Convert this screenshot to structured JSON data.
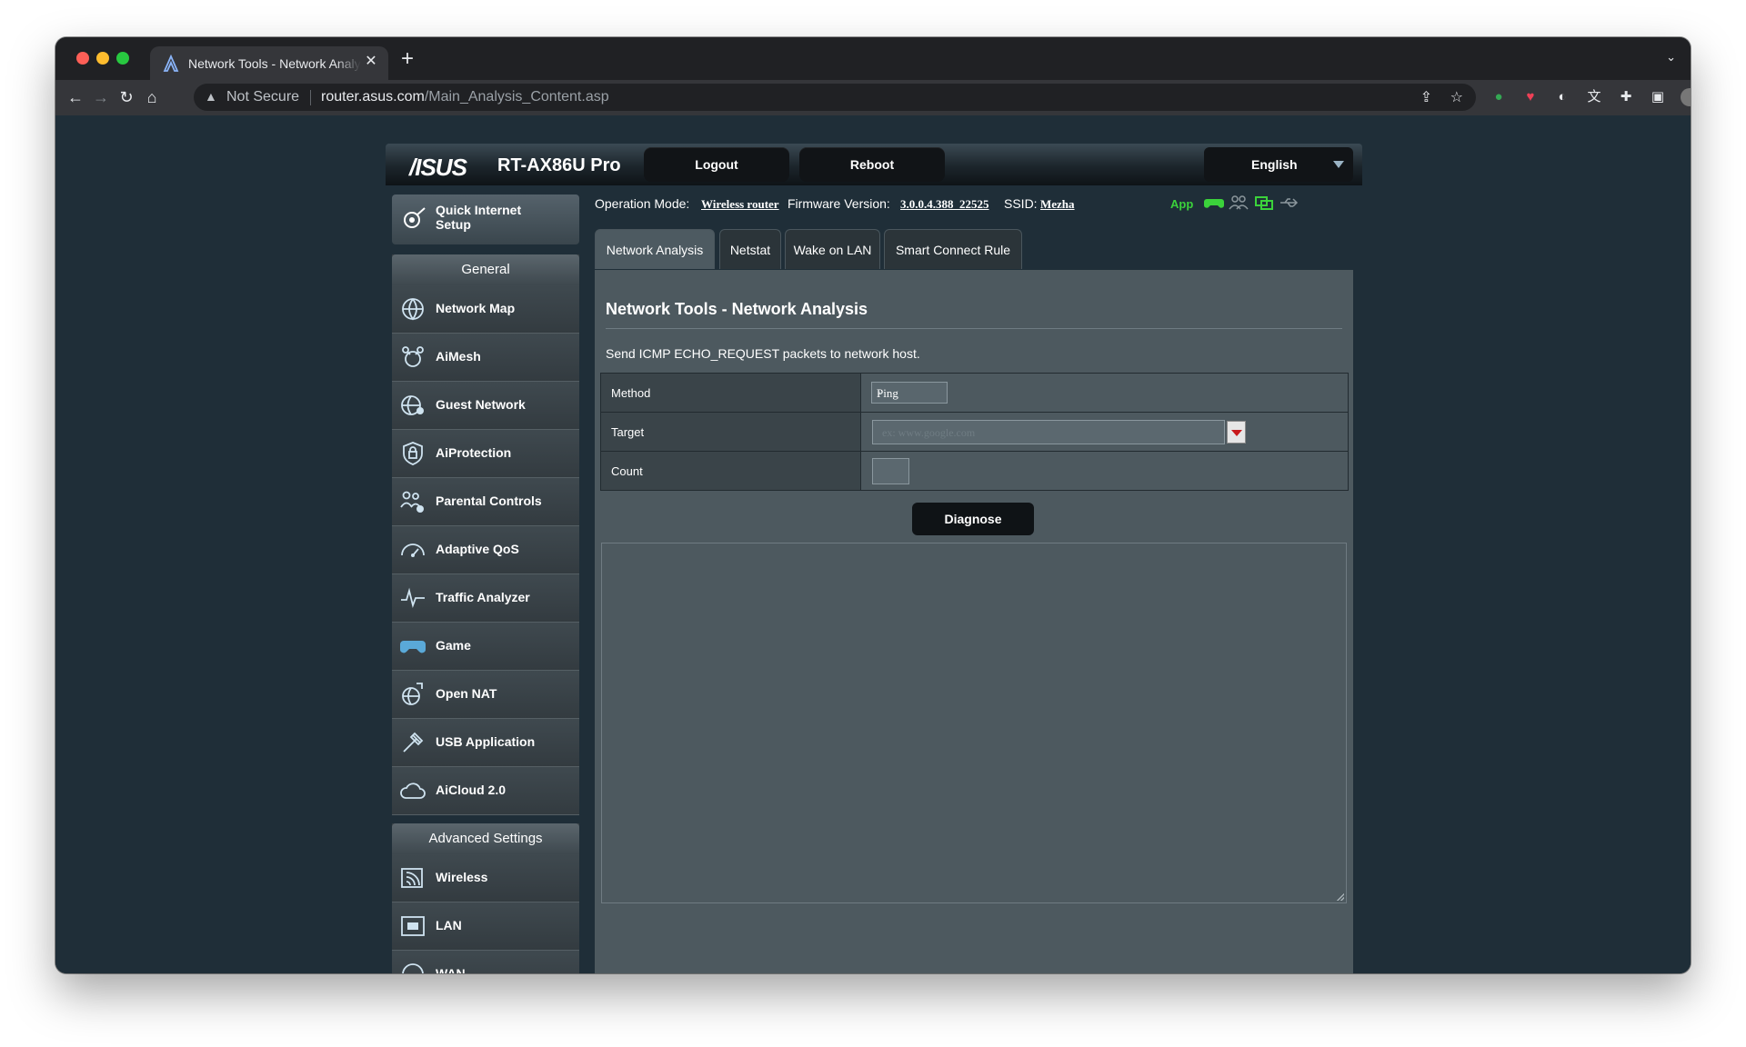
{
  "browser": {
    "tab_title": "Network Tools - Network Analysis",
    "omnibox": {
      "security_label": "Not Secure",
      "host": "router.asus.com",
      "path": "/Main_Analysis_Content.asp"
    }
  },
  "header": {
    "logo": "/ISUS",
    "model": "RT-AX86U Pro",
    "logout_label": "Logout",
    "reboot_label": "Reboot",
    "language": "English"
  },
  "sidebar": {
    "quick_setup": "Quick Internet Setup",
    "general_title": "General",
    "general_items": [
      {
        "label": "Network Map",
        "icon": "globe-icon"
      },
      {
        "label": "AiMesh",
        "icon": "mesh-icon"
      },
      {
        "label": "Guest Network",
        "icon": "guest-globe-icon"
      },
      {
        "label": "AiProtection",
        "icon": "lock-shield-icon"
      },
      {
        "label": "Parental Controls",
        "icon": "family-icon"
      },
      {
        "label": "Adaptive QoS",
        "icon": "speedometer-icon"
      },
      {
        "label": "Traffic Analyzer",
        "icon": "pulse-icon"
      },
      {
        "label": "Game",
        "icon": "gamepad-icon"
      },
      {
        "label": "Open NAT",
        "icon": "open-nat-icon"
      },
      {
        "label": "USB Application",
        "icon": "usb-icon"
      },
      {
        "label": "AiCloud 2.0",
        "icon": "cloud-icon"
      }
    ],
    "advanced_title": "Advanced Settings",
    "advanced_items": [
      {
        "label": "Wireless",
        "icon": "wireless-icon"
      },
      {
        "label": "LAN",
        "icon": "lan-icon"
      },
      {
        "label": "WAN",
        "icon": "wan-icon"
      }
    ]
  },
  "status_bar": {
    "operation_mode_label": "Operation Mode:",
    "operation_mode_value": "Wireless router",
    "firmware_label": "Firmware Version:",
    "firmware_value": "3.0.0.4.388_22525",
    "ssid_label": "SSID:",
    "ssid_value": "Mezha",
    "app_label": "App"
  },
  "tabs": [
    {
      "label": "Network Analysis",
      "active": true
    },
    {
      "label": "Netstat",
      "active": false
    },
    {
      "label": "Wake on LAN",
      "active": false
    },
    {
      "label": "Smart Connect Rule",
      "active": false
    }
  ],
  "main": {
    "title": "Network Tools - Network Analysis",
    "description": "Send ICMP ECHO_REQUEST packets to network host.",
    "method_label": "Method",
    "method_value": "Ping",
    "target_label": "Target",
    "target_placeholder": "ex: www.google.com",
    "count_label": "Count",
    "diagnose_label": "Diagnose",
    "output": ""
  },
  "colors": {
    "page_bg": "#1f2e38",
    "app_green": "#3bd23b",
    "dropdown_red": "#c8191b"
  }
}
